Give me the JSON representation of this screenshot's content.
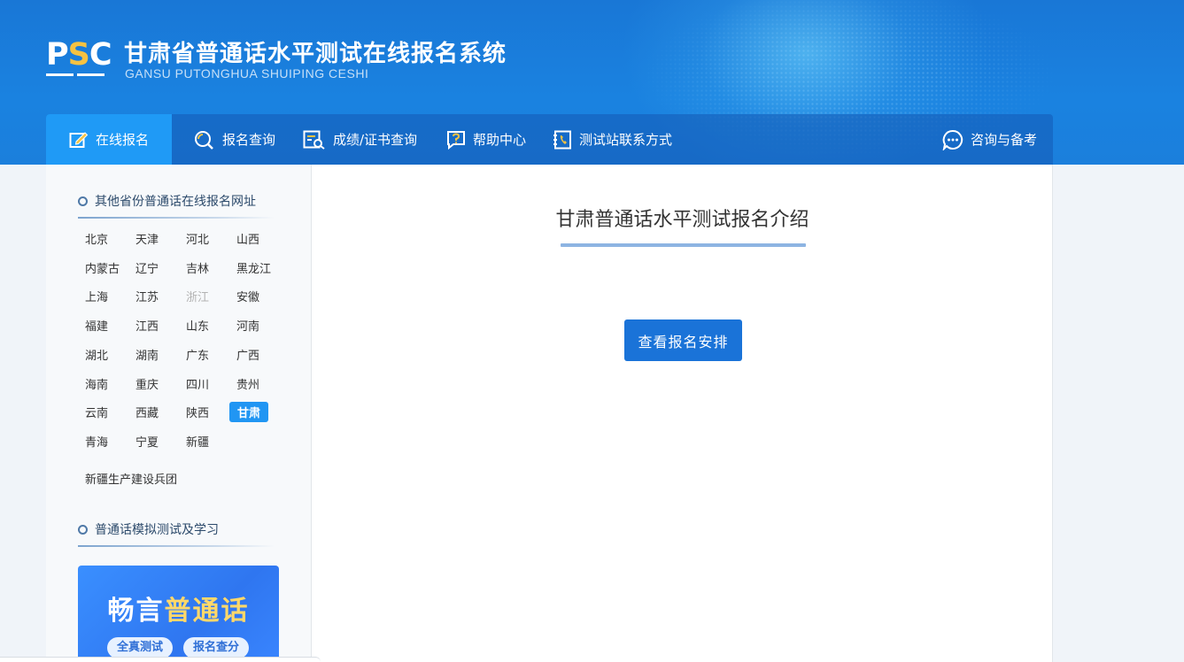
{
  "header": {
    "logo_text_p": "P",
    "logo_text_s": "S",
    "logo_text_c": "C",
    "title": "甘肃省普通话水平测试在线报名系统",
    "subtitle": "GANSU PUTONGHUA SHUIPING CESHI"
  },
  "nav": {
    "items": [
      {
        "label": "在线报名",
        "icon": "edit-icon",
        "active": true
      },
      {
        "label": "报名查询",
        "icon": "search-icon"
      },
      {
        "label": "成绩/证书查询",
        "icon": "certificate-search-icon"
      },
      {
        "label": "帮助中心",
        "icon": "help-icon"
      },
      {
        "label": "测试站联系方式",
        "icon": "phone-book-icon"
      }
    ],
    "consult": {
      "label": "咨询与备考",
      "icon": "chat-bubble-icon"
    }
  },
  "sidebar": {
    "provinces_title": "其他省份普通话在线报名网址",
    "provinces": [
      "北京",
      "天津",
      "河北",
      "山西",
      "内蒙古",
      "辽宁",
      "吉林",
      "黑龙江",
      "上海",
      "江苏",
      "浙江",
      "安徽",
      "福建",
      "江西",
      "山东",
      "河南",
      "湖北",
      "湖南",
      "广东",
      "广西",
      "海南",
      "重庆",
      "四川",
      "贵州",
      "云南",
      "西藏",
      "陕西",
      "甘肃",
      "青海",
      "宁夏",
      "新疆"
    ],
    "province_active": "甘肃",
    "province_disabled": "浙江",
    "extra_region": "新疆生产建设兵团",
    "practice_title": "普通话模拟测试及学习",
    "promo": {
      "title_part1": "畅言",
      "title_part2": "普通话",
      "tag1": "全真测试",
      "tag2": "报名查分"
    }
  },
  "main": {
    "title": "甘肃普通话水平测试报名介绍",
    "button_label": "查看报名安排"
  },
  "colors": {
    "header_blue": "#1a7ad8",
    "nav_active": "#1f9af6",
    "button_blue": "#1a73d8",
    "province_active_bg": "#2196f3",
    "logo_accent": "#f5c242"
  }
}
